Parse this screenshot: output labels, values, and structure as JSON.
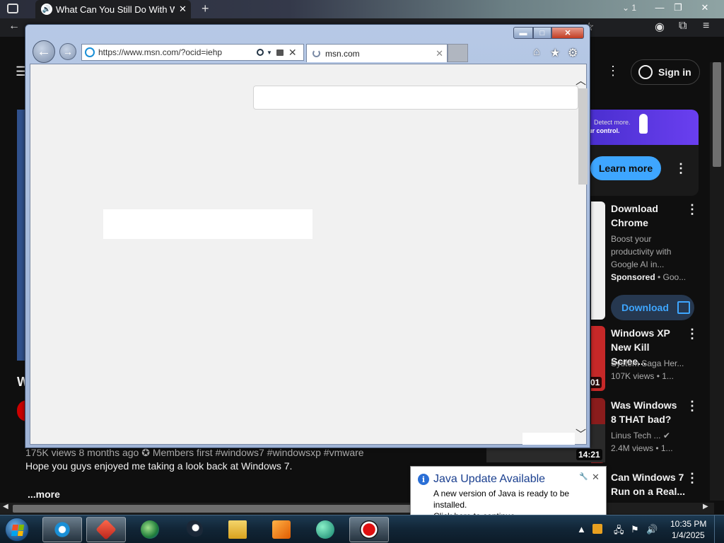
{
  "outer_browser": {
    "tab_title": "What Can You Still Do With Win",
    "tab_count": "1",
    "new_tab_symbol": "+",
    "close_symbol": "✕",
    "minimize_symbol": "—",
    "maximize_symbol": "❐",
    "window_close_symbol": "✕"
  },
  "youtube": {
    "sign_in": "Sign in",
    "ad_banner": {
      "line1": "Detect more.",
      "line2": "ur control."
    },
    "learn_more": "Learn more",
    "sponsored": {
      "title": "Download Chrome",
      "description": "Boost your productivity with Google AI in...",
      "sponsored_label": "Sponsored",
      "advertiser": " • Goo...",
      "button": "Download"
    },
    "recommendations": [
      {
        "title": "Windows XP New Kill Scree...",
        "channel": "System Saga Her...",
        "stats": "107K views • 1...",
        "duration": "01"
      },
      {
        "title": "Was Windows 8 THAT bad?",
        "channel": "Linus Tech ...",
        "stats": "2.4M views • 1...",
        "duration": "14:21"
      },
      {
        "title": "Can Windows 7 Run on a Real...",
        "channel": "",
        "stats": ""
      }
    ],
    "channel_initial": "W",
    "description_meta": "175K views  8 months ago  ✪ Members first  #windows7 #windowsxp #vmware",
    "description_text": "Hope you guys enjoyed me taking a look back at Windows 7.",
    "more_link": "...more"
  },
  "ie": {
    "address_url": "https://www.msn.com/?ocid=iehp",
    "tab_title": "msn.com",
    "tab_close": "✕",
    "minimize": "▬",
    "maximize": "□",
    "close": "✕",
    "back_arrow": "←",
    "forward_arrow": "→"
  },
  "java_popup": {
    "title": "Java Update Available",
    "message_line1": "A new version of Java is ready to be installed.",
    "message_line2": "Click here to continue."
  },
  "taskbar": {
    "time": "10:35 PM",
    "date": "1/4/2025"
  }
}
